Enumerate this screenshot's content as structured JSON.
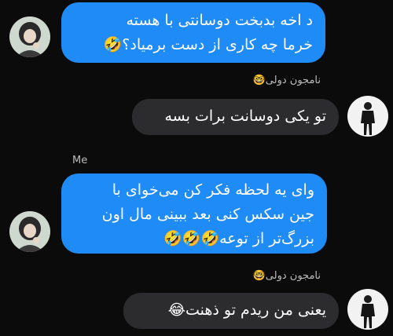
{
  "messages": [
    {
      "sender": "me",
      "lines": [
        "د اخه بدبخت دوسانتی با هسته",
        "خرما چه کاری از دست برمیاد؟🤣"
      ]
    },
    {
      "sender": "them",
      "name": "نامجون دولی🤓",
      "lines": [
        "تو یکی دوسانت برات بسه"
      ]
    },
    {
      "sender": "me",
      "name": "Me",
      "lines": [
        "وای یه لحظه فکر کن می‌خوای با",
        "جین سکس کنی بعد ببینی مال اون",
        "بزرگ‌تر از توعه🤣🤣🤣"
      ]
    },
    {
      "sender": "them",
      "name": "نامجون دولی🤓",
      "lines": [
        "یعنی من ریدم تو ذهنت😂"
      ]
    }
  ],
  "colors": {
    "me_bubble": "#1f8bf7",
    "them_bubble": "#2c2c2e",
    "background": "#0b0b0b"
  }
}
